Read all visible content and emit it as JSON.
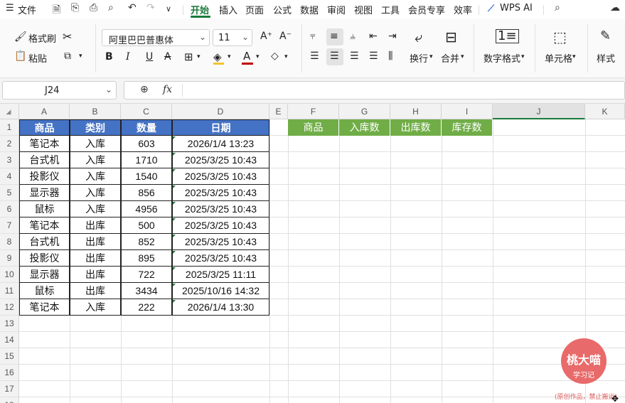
{
  "menubar": {
    "menu_label": "文件",
    "tabs": [
      "开始",
      "插入",
      "页面",
      "公式",
      "数据",
      "审阅",
      "视图",
      "工具",
      "会员专享",
      "效率"
    ],
    "active_tab": "开始",
    "wps_ai": "WPS AI"
  },
  "ribbon": {
    "format_painter": "格式刷",
    "paste": "粘贴",
    "font_name": "阿里巴巴普惠体",
    "font_size": "11",
    "wrap": "换行",
    "merge": "合并",
    "number_format": "数字格式",
    "cell": "单元格",
    "style": "样式"
  },
  "formula_bar": {
    "name_box": "J24",
    "fx": "fx",
    "formula": ""
  },
  "sheet": {
    "col_headers": [
      "A",
      "B",
      "C",
      "D",
      "E",
      "F",
      "G",
      "H",
      "I",
      "J",
      "K"
    ],
    "row_headers": [
      "1",
      "2",
      "3",
      "4",
      "5",
      "6",
      "7",
      "8",
      "9",
      "10",
      "11",
      "12",
      "13",
      "14",
      "15",
      "16",
      "17",
      "18"
    ],
    "main_headers": [
      "商品",
      "类别",
      "数量",
      "日期"
    ],
    "main_rows": [
      [
        "笔记本",
        "入库",
        "603",
        "2026/1/4 13:23"
      ],
      [
        "台式机",
        "入库",
        "1710",
        "2025/3/25 10:43"
      ],
      [
        "投影仪",
        "入库",
        "1540",
        "2025/3/25 10:43"
      ],
      [
        "显示器",
        "入库",
        "856",
        "2025/3/25 10:43"
      ],
      [
        "鼠标",
        "入库",
        "4956",
        "2025/3/25 10:43"
      ],
      [
        "笔记本",
        "出库",
        "500",
        "2025/3/25 10:43"
      ],
      [
        "台式机",
        "出库",
        "852",
        "2025/3/25 10:43"
      ],
      [
        "投影仪",
        "出库",
        "895",
        "2025/3/25 10:43"
      ],
      [
        "显示器",
        "出库",
        "722",
        "2025/3/25 11:11"
      ],
      [
        "鼠标",
        "出库",
        "3434",
        "2025/10/16 14:32"
      ],
      [
        "笔记本",
        "入库",
        "222",
        "2026/1/4 13:30"
      ]
    ],
    "summary_headers": [
      "商品",
      "入库数",
      "出库数",
      "库存数"
    ]
  },
  "watermark": {
    "line1": "桃大喵",
    "line2": "学习记",
    "caption": "(原创作品，禁止搬运)"
  },
  "colors": {
    "blue_header": "#4472c4",
    "green_header": "#70ad47",
    "brand_green": "#1a7a3a",
    "watermark_red": "#e05a5a"
  }
}
